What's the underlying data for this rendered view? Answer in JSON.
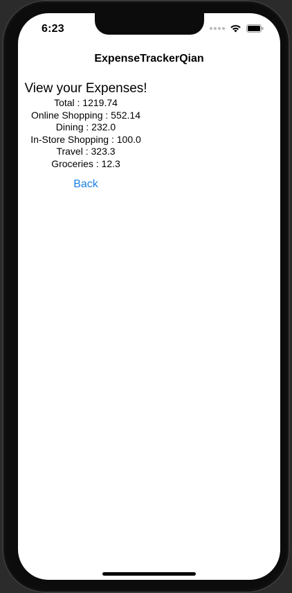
{
  "status_bar": {
    "time": "6:23",
    "icons": [
      "cellular-dots-icon",
      "wifi-icon",
      "battery-icon"
    ]
  },
  "nav": {
    "title": "ExpenseTrackerQian"
  },
  "main": {
    "heading": "View your Expenses!",
    "expenses": [
      "Total : 1219.74",
      "Online Shopping : 552.14",
      "Dining : 232.0",
      "In-Store Shopping : 100.0",
      "Travel : 323.3",
      "Groceries : 12.3"
    ],
    "back_label": "Back"
  },
  "colors": {
    "accent": "#1a7fe0",
    "background": "#ffffff",
    "text": "#000000",
    "device_frame": "#0c0c0c"
  }
}
